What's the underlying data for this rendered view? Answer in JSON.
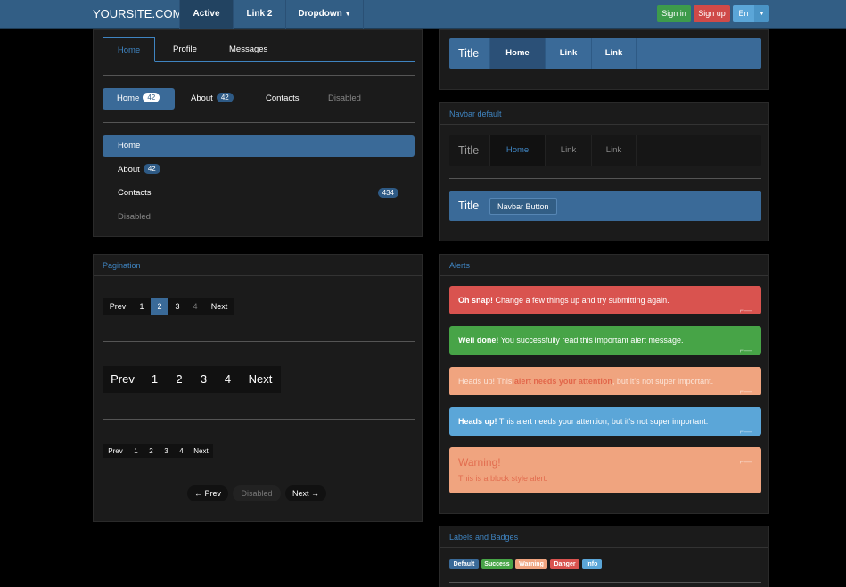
{
  "topbar": {
    "brand": "YOURSITE.COM",
    "nav": [
      "Active",
      "Link 2",
      "Dropdown"
    ],
    "signin": "Sign in",
    "signup": "Sign up",
    "lang": "En",
    "colors": {
      "bar": "#325e85",
      "signin": "#3d9b4b",
      "signup": "#cf4a48",
      "lang": "#5ba6d8"
    }
  },
  "tabs": [
    "Home",
    "Profile",
    "Messages"
  ],
  "pills": [
    {
      "label": "Home",
      "badge": "42"
    },
    {
      "label": "About",
      "badge": "42"
    },
    {
      "label": "Contacts"
    },
    {
      "label": "Disabled"
    }
  ],
  "stacked": [
    {
      "label": "Home"
    },
    {
      "label": "About",
      "badge": "42"
    },
    {
      "label": "Contacts",
      "badge": "434"
    },
    {
      "label": "Disabled"
    }
  ],
  "pagination": {
    "title": "Pagination",
    "prev": "Prev",
    "next": "Next",
    "pages": [
      "1",
      "2",
      "3",
      "4"
    ],
    "pager_prev": "← Prev",
    "pager_disabled": "Disabled",
    "pager_next": "Next →"
  },
  "navbars": {
    "title": "Navbar default",
    "brand": "Title",
    "items": [
      "Home",
      "Link",
      "Link"
    ],
    "button": "Navbar Button"
  },
  "alerts": {
    "title": "Alerts",
    "danger_strong": "Oh snap!",
    "danger_text": " Change a few things up and try submitting again.",
    "success_strong": "Well done!",
    "success_text": " You successfully read this important alert message.",
    "warn_a": "Heads up!",
    "warn_b": " This ",
    "warn_c": "alert needs your attention",
    "warn_d": ", but it's not super important.",
    "info_strong": "Heads up!",
    "info_text": " This alert needs your attention, but it's not super important.",
    "block_title": "Warning!",
    "block_text": "This is a block style alert."
  },
  "labels": {
    "title": "Labels and Badges",
    "items": [
      "Default",
      "Success",
      "Warning",
      "Danger",
      "Info"
    ],
    "colors": [
      "#3a6a98",
      "#47a447",
      "#f0a47f",
      "#d9534f",
      "#5ba6d8"
    ]
  }
}
